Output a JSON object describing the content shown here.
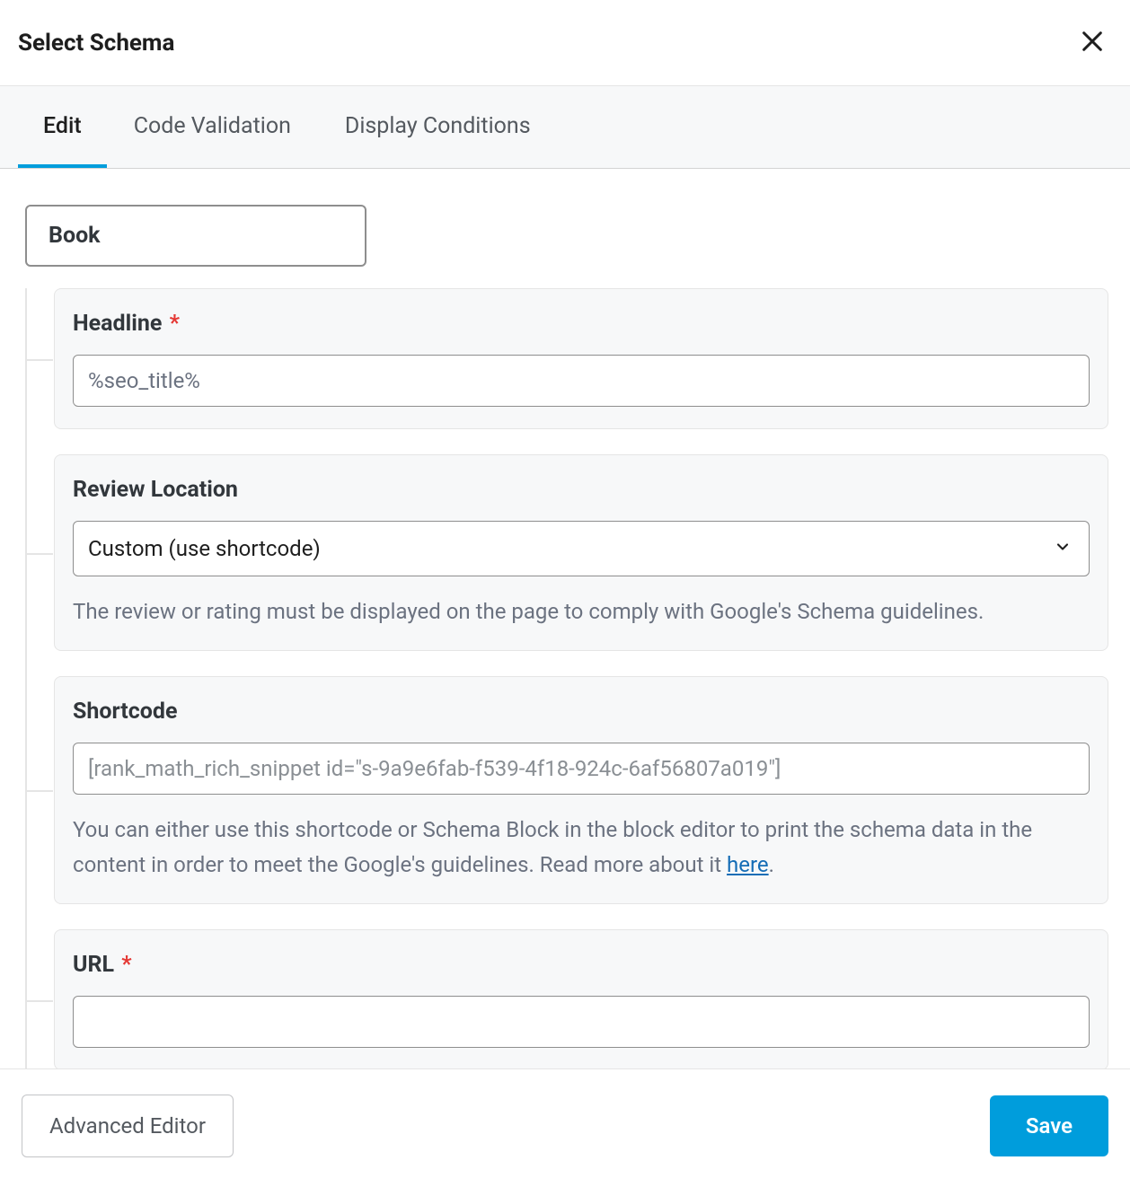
{
  "modal": {
    "title": "Select Schema"
  },
  "tabs": [
    {
      "label": "Edit",
      "active": true
    },
    {
      "label": "Code Validation",
      "active": false
    },
    {
      "label": "Display Conditions",
      "active": false
    }
  ],
  "schema_type": "Book",
  "fields": {
    "headline": {
      "label": "Headline",
      "required": true,
      "value": "%seo_title%"
    },
    "review_location": {
      "label": "Review Location",
      "selected": "Custom (use shortcode)",
      "help": "The review or rating must be displayed on the page to comply with Google's Schema guidelines."
    },
    "shortcode": {
      "label": "Shortcode",
      "value": "[rank_math_rich_snippet id=\"s-9a9e6fab-f539-4f18-924c-6af56807a019\"]",
      "help_pre": "You can either use this shortcode or Schema Block in the block editor to print the schema data in the content in order to meet the Google's guidelines. Read more about it ",
      "help_link": "here",
      "help_post": "."
    },
    "url": {
      "label": "URL",
      "required": true,
      "value": ""
    }
  },
  "footer": {
    "advanced": "Advanced Editor",
    "save": "Save"
  }
}
